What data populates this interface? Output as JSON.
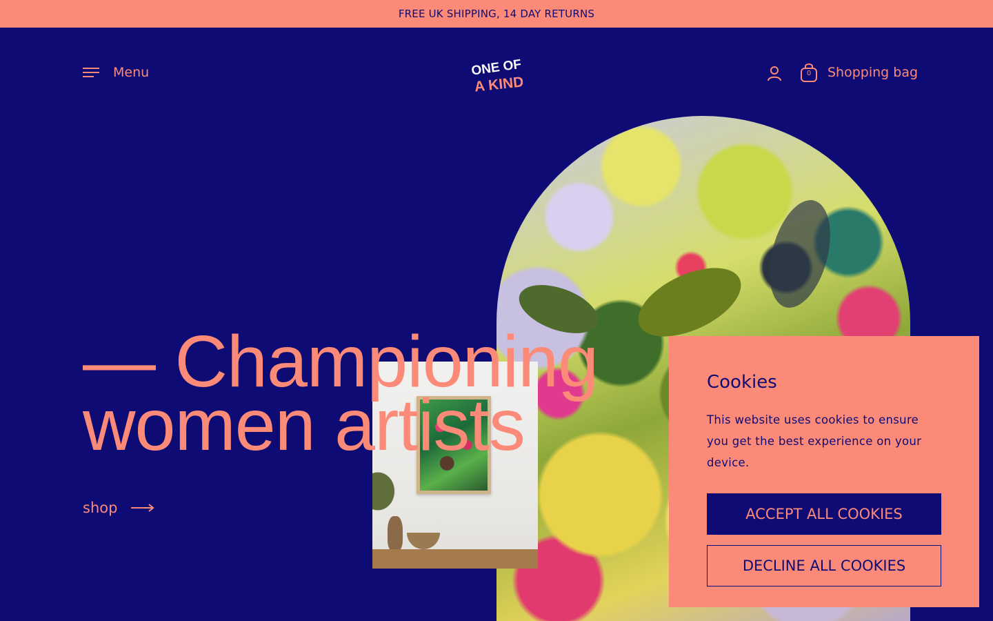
{
  "announcement": {
    "text": "FREE UK SHIPPING, 14 DAY RETURNS"
  },
  "header": {
    "menu_label": "Menu",
    "logo_text": {
      "line1": "ONE OF",
      "line2": "A KIND"
    },
    "cart_count": "0",
    "cart_label": "Shopping bag"
  },
  "hero": {
    "headline_line1": "— Championing",
    "headline_line2": "women artists",
    "cta_label": "shop"
  },
  "cookie_banner": {
    "title": "Cookies",
    "message": "This website uses cookies to ensure you get the best experience on your device.",
    "accept_label": "ACCEPT ALL COOKIES",
    "decline_label": "DECLINE ALL COOKIES"
  },
  "colors": {
    "background": "#0e0c74",
    "accent": "#fc8a78"
  },
  "icons": {
    "menu": "hamburger-icon",
    "account": "user-icon",
    "cart": "shopping-bag-icon",
    "cta": "arrow-right-icon"
  }
}
